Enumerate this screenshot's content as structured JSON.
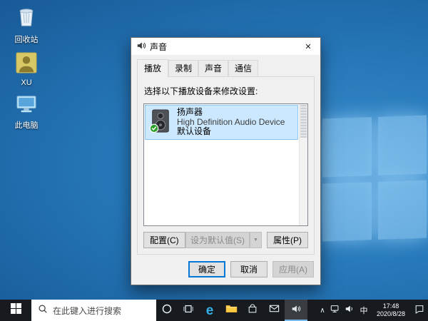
{
  "desktop": {
    "icons": [
      {
        "label": "回收站"
      },
      {
        "label": "XU"
      },
      {
        "label": "此电脑"
      }
    ]
  },
  "dialog": {
    "title": "声音",
    "close_glyph": "✕",
    "tabs": [
      {
        "label": "播放"
      },
      {
        "label": "录制"
      },
      {
        "label": "声音"
      },
      {
        "label": "通信"
      }
    ],
    "instruction": "选择以下播放设备来修改设置:",
    "device": {
      "name": "扬声器",
      "description": "High Definition Audio Device",
      "status": "默认设备"
    },
    "buttons": {
      "configure": "配置(C)",
      "set_default": "设为默认值(S)",
      "dropdown_glyph": "▼",
      "properties": "属性(P)",
      "ok": "确定",
      "cancel": "取消",
      "apply": "应用(A)"
    }
  },
  "taskbar": {
    "search_placeholder": "在此键入进行搜索",
    "edge_glyph": "e",
    "tray": {
      "chevron_glyph": "∧",
      "ime": "中",
      "time": "17:48",
      "date": "2020/8/28"
    }
  },
  "colors": {
    "accent": "#0078d7",
    "selection_fill": "#cce8ff",
    "selection_border": "#8ec6f5",
    "desktop_blue": "#2678ba",
    "taskbar": "#171a1f"
  }
}
